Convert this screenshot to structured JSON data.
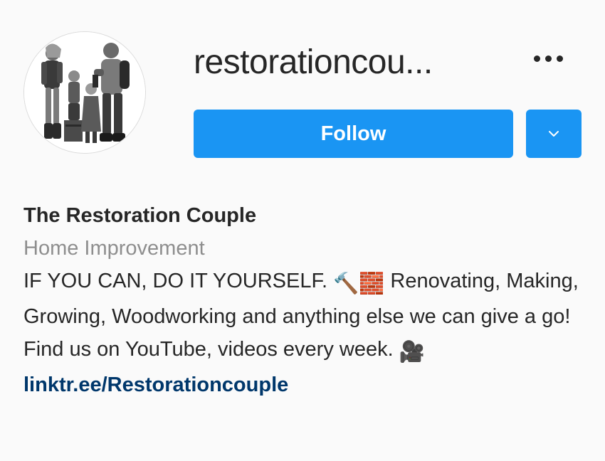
{
  "profile": {
    "username": "restorationcouple",
    "username_display": "restorationcou...",
    "follow_label": "Follow",
    "full_name": "The Restoration Couple",
    "category": "Home Improvement",
    "bio_part1": "IF YOU CAN, DO IT YOURSELF. ",
    "bio_emoji1": "🔨",
    "bio_emoji2": "🧱",
    "bio_part2": " Renovating, Making, Growing, Woodworking and anything else we can give a go! Find us on YouTube, videos every week. ",
    "bio_emoji3": "🎥",
    "link": "linktr.ee/Restorationcouple"
  },
  "icons": {
    "more": "more-options-icon",
    "dropdown": "chevron-down-icon",
    "avatar": "profile-avatar"
  },
  "colors": {
    "accent": "#1a95f3",
    "link": "#00376b",
    "muted": "#8e8e8e",
    "text": "#262626",
    "background": "#fafafa"
  }
}
